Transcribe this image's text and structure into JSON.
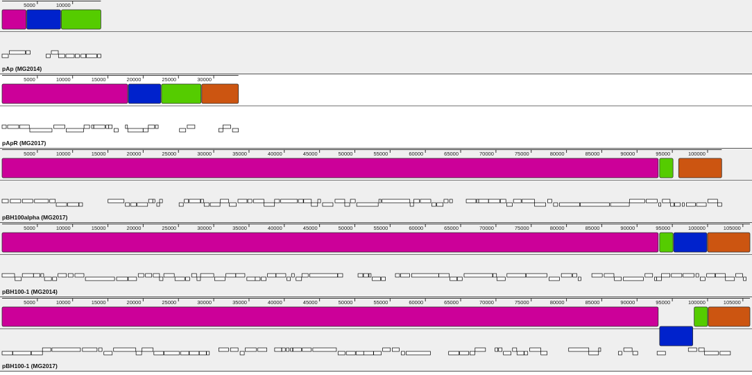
{
  "colors": {
    "magenta": "#cc0099",
    "blue": "#0022cc",
    "green": "#55cc00",
    "orange": "#cc5511",
    "panel_gray": "#efefef",
    "panel_white": "#ffffff"
  },
  "genomes": [
    {
      "name": "pAp (MG2014)",
      "background": "gray",
      "ruler_ticks": [
        5000,
        10000
      ],
      "ruler_length": 14000,
      "blocks": [
        {
          "color": "magenta",
          "start": 0,
          "end": 3400
        },
        {
          "color": "blue",
          "start": 3500,
          "end": 8300
        },
        {
          "color": "green",
          "start": 8400,
          "end": 14000
        }
      ]
    },
    {
      "name": "pApR (MG2017)",
      "background": "white",
      "ruler_ticks": [
        5000,
        10000,
        15000,
        20000,
        25000,
        30000
      ],
      "ruler_length": 33500,
      "blocks": [
        {
          "color": "magenta",
          "start": 0,
          "end": 17800
        },
        {
          "color": "blue",
          "start": 17900,
          "end": 22500
        },
        {
          "color": "green",
          "start": 22600,
          "end": 28200
        },
        {
          "color": "orange",
          "start": 28300,
          "end": 33500
        }
      ]
    },
    {
      "name": "pBH100alpha (MG2017)",
      "background": "gray",
      "ruler_ticks": [
        5000,
        10000,
        15000,
        20000,
        25000,
        30000,
        35000,
        40000,
        45000,
        50000,
        55000,
        60000,
        65000,
        70000,
        75000,
        80000,
        85000,
        90000,
        95000,
        100000
      ],
      "ruler_length": 102000,
      "blocks": [
        {
          "color": "magenta",
          "start": 0,
          "end": 93000
        },
        {
          "color": "green",
          "start": 93200,
          "end": 95100
        },
        {
          "color": "orange",
          "start": 95900,
          "end": 102000
        }
      ]
    },
    {
      "name": "pBH100-1 (MG2014)",
      "background": "gray",
      "ruler_ticks": [
        5000,
        10000,
        15000,
        20000,
        25000,
        30000,
        35000,
        40000,
        45000,
        50000,
        55000,
        60000,
        65000,
        70000,
        75000,
        80000,
        85000,
        90000,
        95000,
        100000,
        105000
      ],
      "ruler_length": 106000,
      "blocks": [
        {
          "color": "magenta",
          "start": 0,
          "end": 93000
        },
        {
          "color": "green",
          "start": 93200,
          "end": 95100
        },
        {
          "color": "blue",
          "start": 95200,
          "end": 99900
        },
        {
          "color": "orange",
          "start": 100000,
          "end": 106000
        }
      ]
    },
    {
      "name": "pBH100-1 (MG2017)",
      "background": "gray",
      "ruler_ticks": [
        5000,
        10000,
        15000,
        20000,
        25000,
        30000,
        35000,
        40000,
        45000,
        50000,
        55000,
        60000,
        65000,
        70000,
        75000,
        80000,
        85000,
        90000,
        95000,
        100000,
        105000
      ],
      "ruler_length": 106000,
      "blocks": [
        {
          "color": "magenta",
          "start": 0,
          "end": 93000
        },
        {
          "color": "blue",
          "start": 93200,
          "end": 97900,
          "strand": "reverse"
        },
        {
          "color": "green",
          "start": 98100,
          "end": 100000
        },
        {
          "color": "orange",
          "start": 100100,
          "end": 106000
        }
      ]
    }
  ]
}
